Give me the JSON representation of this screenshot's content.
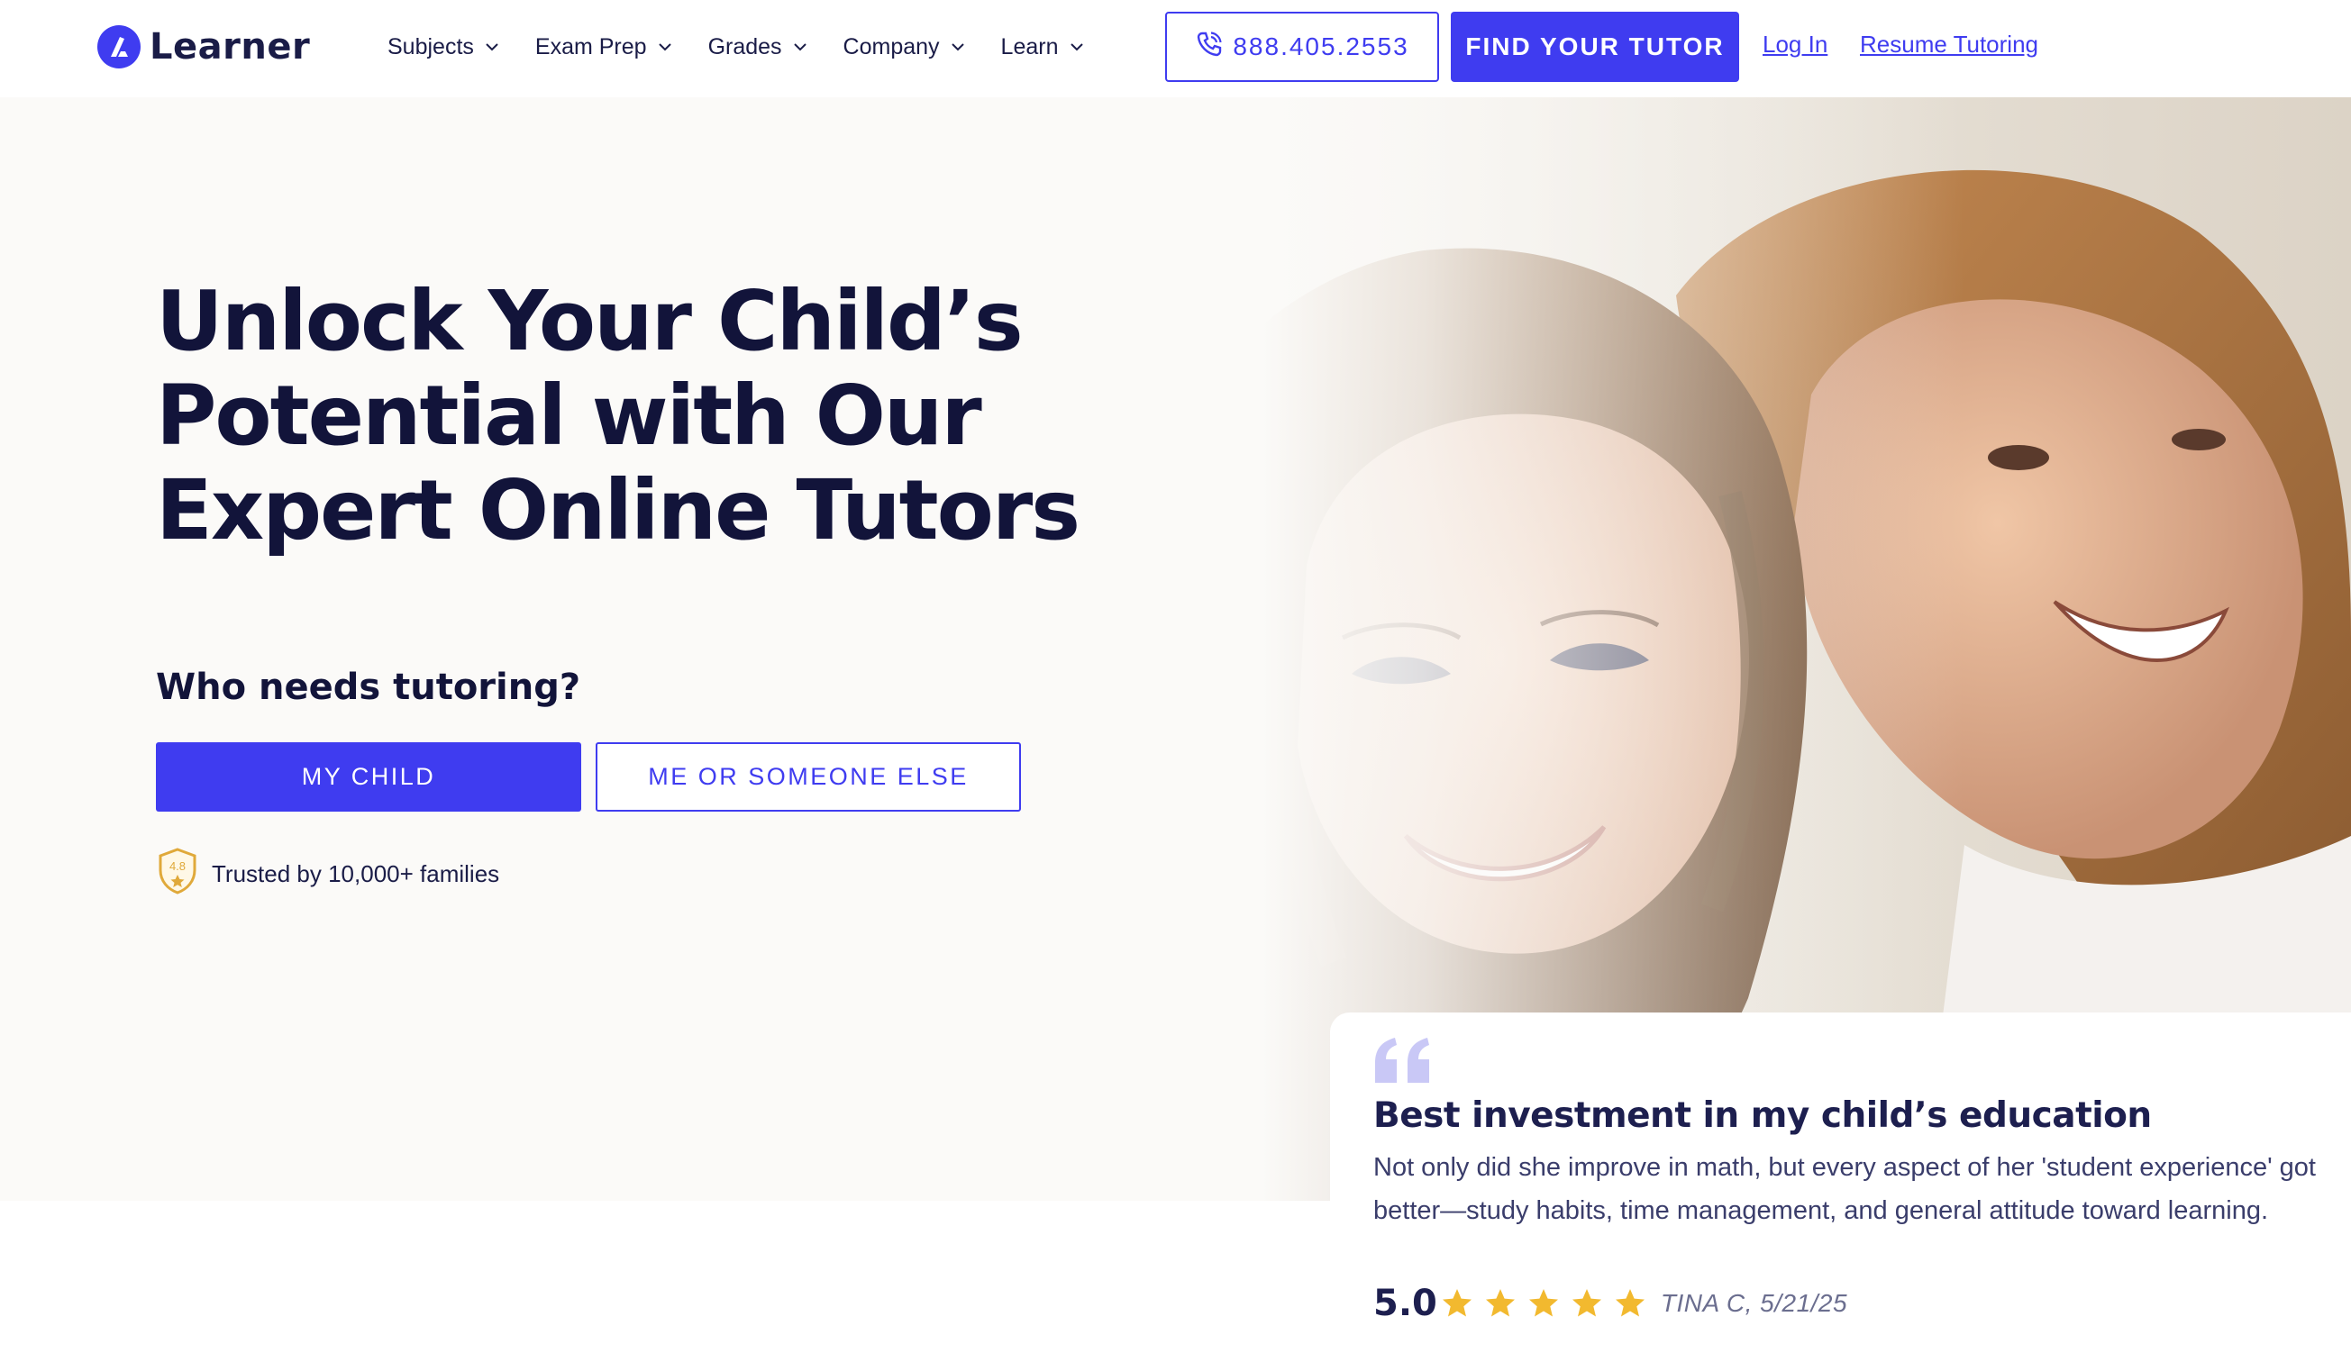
{
  "brand": {
    "name": "Learner",
    "accent": "#3f3cf0",
    "text": "#12143a"
  },
  "nav": {
    "items": [
      {
        "label": "Subjects"
      },
      {
        "label": "Exam Prep"
      },
      {
        "label": "Grades"
      },
      {
        "label": "Company"
      },
      {
        "label": "Learn"
      }
    ],
    "phone": "888.405.2553",
    "find_tutor": "FIND YOUR TUTOR",
    "login": "Log In",
    "resume": "Resume Tutoring"
  },
  "hero": {
    "headline": "Unlock Your Child’s\nPotential with Our\nExpert Online Tutors",
    "question": "Who needs tutoring?",
    "option_child": "MY CHILD",
    "option_other": "ME OR SOMEONE ELSE",
    "rating_badge": "4.8",
    "trust_text": "Trusted by 10,000+ families"
  },
  "testimonial": {
    "title": "Best investment in my child’s education",
    "body": "Not only did she improve in math, but every aspect of her 'student experience' got better—study habits, time management, and general attitude toward learning.",
    "score": "5.0",
    "stars": 5,
    "author": "TINA C, 5/21/25"
  }
}
